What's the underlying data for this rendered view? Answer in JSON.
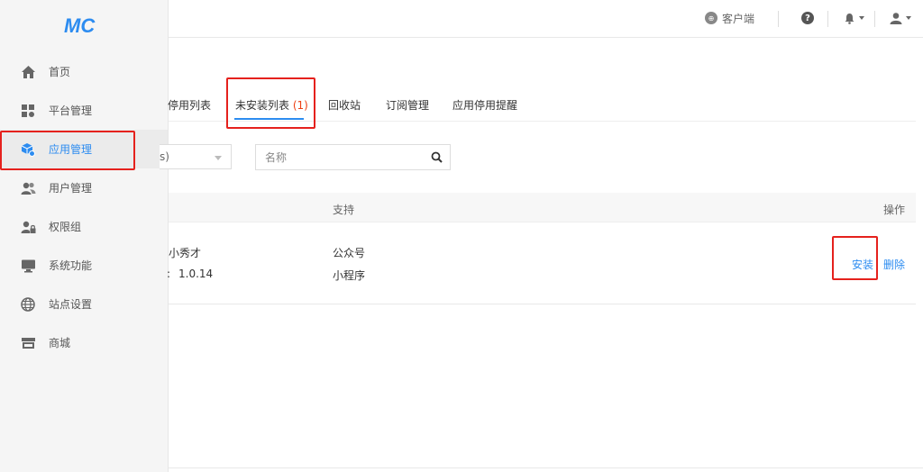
{
  "topbar": {
    "client_label": "客户端",
    "client_icon": "client-circle-icon",
    "help_icon": "question-icon",
    "bell_icon": "bell-icon",
    "user_icon": "user-icon"
  },
  "sidebar": {
    "logo_text": "MC",
    "items": [
      {
        "label": "首页",
        "icon": "home-icon"
      },
      {
        "label": "平台管理",
        "icon": "grid-icon"
      },
      {
        "label": "应用管理",
        "icon": "cube-icon",
        "active": true
      },
      {
        "label": "用户管理",
        "icon": "users-icon"
      },
      {
        "label": "权限组",
        "icon": "user-lock-icon"
      },
      {
        "label": "系统功能",
        "icon": "monitor-icon"
      },
      {
        "label": "站点设置",
        "icon": "globe-icon"
      },
      {
        "label": "商城",
        "icon": "store-icon"
      }
    ]
  },
  "tabs": [
    {
      "label": "停用列表"
    },
    {
      "label": "未安装列表",
      "count": "(1)",
      "active": true
    },
    {
      "label": "回收站"
    },
    {
      "label": "订阅管理"
    },
    {
      "label": "应用停用提醒"
    }
  ],
  "filter": {
    "select_value": "s)",
    "search_placeholder": "名称"
  },
  "table": {
    "headers": {
      "support": "支持",
      "action": "操作"
    },
    "rows": [
      {
        "name": "小秀才",
        "version_label": ":",
        "version": "1.0.14",
        "support": [
          "公众号",
          "小程序"
        ],
        "install_label": "安装",
        "delete_label": "删除"
      }
    ]
  },
  "colors": {
    "accent": "#2d8cf0",
    "highlight": "#e5211d",
    "count": "#ed4014"
  }
}
